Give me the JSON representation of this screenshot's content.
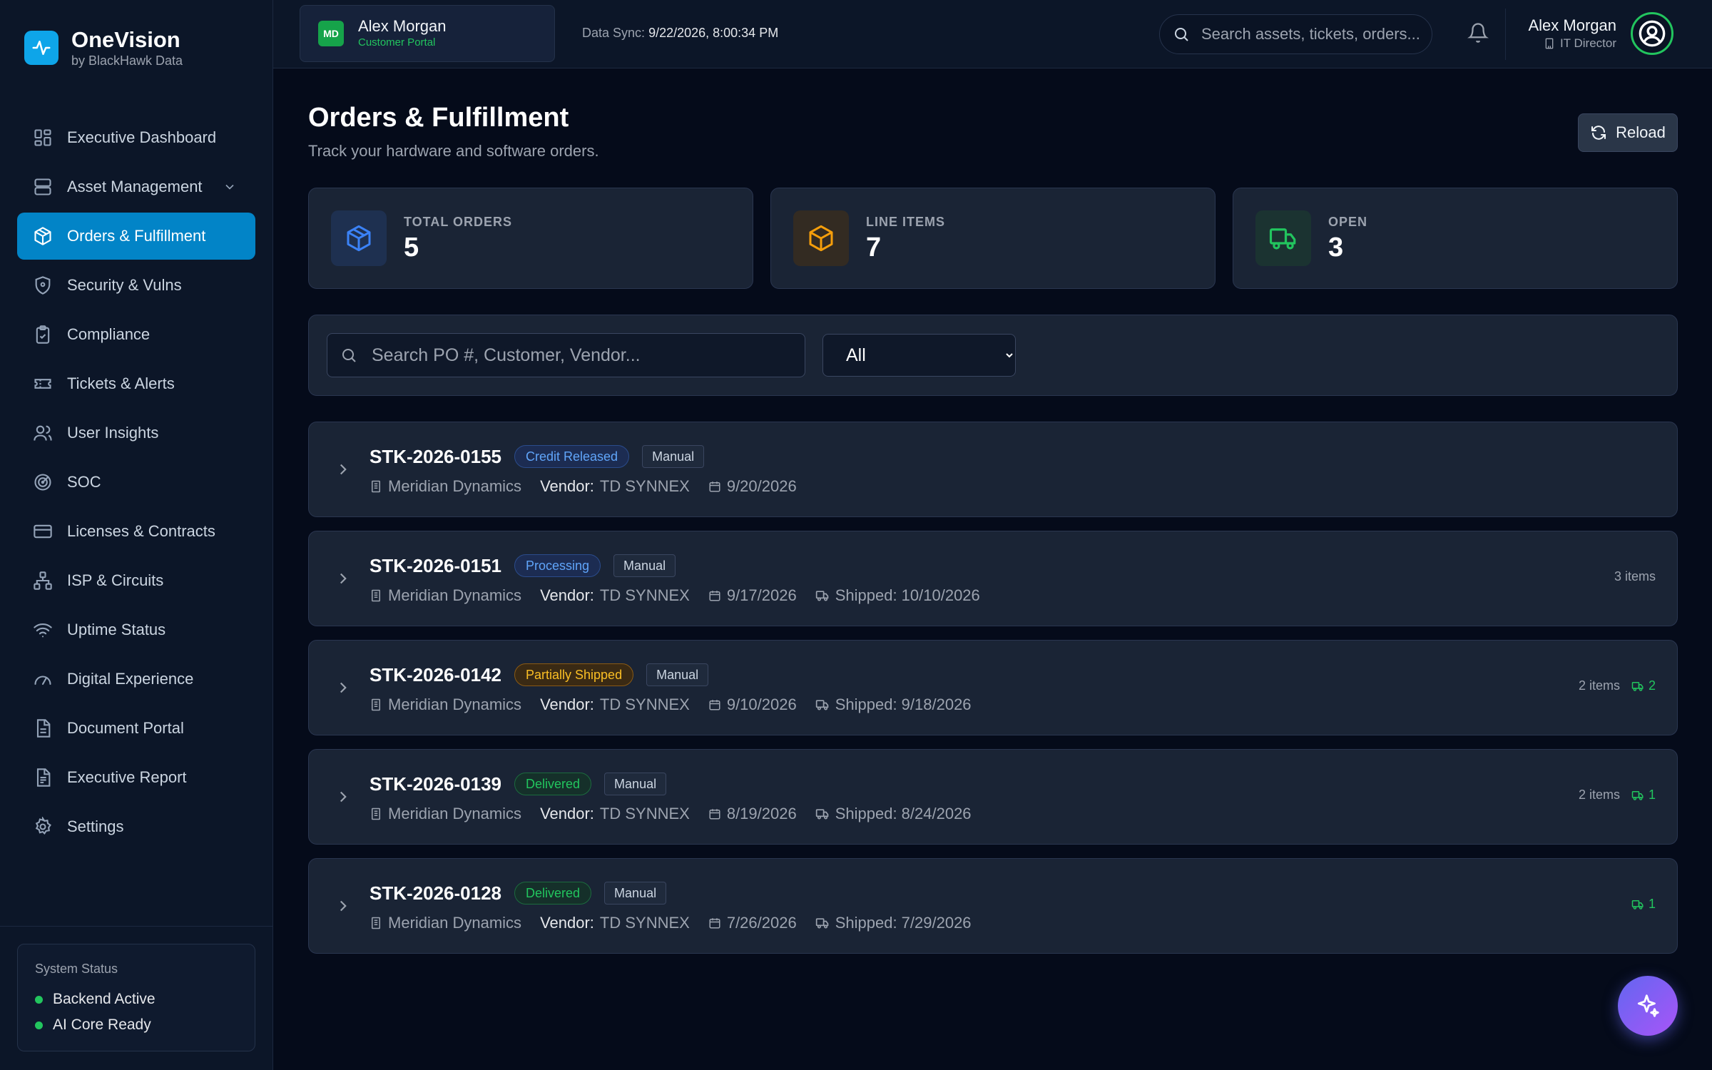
{
  "brand": {
    "name": "OneVision",
    "sub": "by BlackHawk Data"
  },
  "nav": [
    {
      "label": "Executive Dashboard",
      "icon": "dashboard-icon"
    },
    {
      "label": "Asset Management",
      "icon": "server-icon",
      "expandable": true
    },
    {
      "label": "Orders & Fulfillment",
      "icon": "package-icon",
      "active": true
    },
    {
      "label": "Security & Vulns",
      "icon": "shield-icon"
    },
    {
      "label": "Compliance",
      "icon": "clipboard-check-icon"
    },
    {
      "label": "Tickets & Alerts",
      "icon": "ticket-icon"
    },
    {
      "label": "User Insights",
      "icon": "users-icon"
    },
    {
      "label": "SOC",
      "icon": "radar-icon"
    },
    {
      "label": "Licenses & Contracts",
      "icon": "credit-card-icon"
    },
    {
      "label": "ISP & Circuits",
      "icon": "network-icon"
    },
    {
      "label": "Uptime Status",
      "icon": "wifi-icon"
    },
    {
      "label": "Digital Experience",
      "icon": "gauge-icon"
    },
    {
      "label": "Document Portal",
      "icon": "document-icon"
    },
    {
      "label": "Executive Report",
      "icon": "report-icon"
    },
    {
      "label": "Settings",
      "icon": "gear-icon"
    }
  ],
  "system_status": {
    "title": "System Status",
    "items": [
      "Backend Active",
      "AI Core Ready"
    ],
    "color": "#22c55e"
  },
  "topbar": {
    "tenant": {
      "badge": "MD",
      "name": "Alex Morgan",
      "sub": "Customer Portal"
    },
    "sync_label": "Data Sync:",
    "sync_value": "9/22/2026, 8:00:34 PM",
    "search_placeholder": "Search assets, tickets, orders...",
    "user": {
      "name": "Alex Morgan",
      "role": "IT Director"
    }
  },
  "page": {
    "title": "Orders & Fulfillment",
    "subtitle": "Track your hardware and software orders.",
    "reload_label": "Reload"
  },
  "stats": [
    {
      "label": "TOTAL ORDERS",
      "value": "5",
      "icon": "package-icon",
      "color": "#3b82f6"
    },
    {
      "label": "LINE ITEMS",
      "value": "7",
      "icon": "box-icon",
      "color": "#f59e0b"
    },
    {
      "label": "OPEN",
      "value": "3",
      "icon": "truck-icon",
      "color": "#22c55e"
    }
  ],
  "filters": {
    "search_placeholder": "Search PO #, Customer, Vendor...",
    "status_options": [
      "All"
    ],
    "status_selected": "All"
  },
  "orders": [
    {
      "po": "STK-2026-0155",
      "status": "Credit Released",
      "status_color": "#60a5fa",
      "source": "Manual",
      "customer": "Meridian Dynamics",
      "vendor_label": "Vendor:",
      "vendor": "TD SYNNEX",
      "date": "9/20/2026",
      "shipped": "",
      "items": "",
      "ship_count": ""
    },
    {
      "po": "STK-2026-0151",
      "status": "Processing",
      "status_color": "#60a5fa",
      "source": "Manual",
      "customer": "Meridian Dynamics",
      "vendor_label": "Vendor:",
      "vendor": "TD SYNNEX",
      "date": "9/17/2026",
      "shipped": "Shipped: 10/10/2026",
      "items": "3 items",
      "ship_count": ""
    },
    {
      "po": "STK-2026-0142",
      "status": "Partially Shipped",
      "status_color": "#f59e0b",
      "source": "Manual",
      "customer": "Meridian Dynamics",
      "vendor_label": "Vendor:",
      "vendor": "TD SYNNEX",
      "date": "9/10/2026",
      "shipped": "Shipped: 9/18/2026",
      "items": "2 items",
      "ship_count": "2"
    },
    {
      "po": "STK-2026-0139",
      "status": "Delivered",
      "status_color": "#22c55e",
      "source": "Manual",
      "customer": "Meridian Dynamics",
      "vendor_label": "Vendor:",
      "vendor": "TD SYNNEX",
      "date": "8/19/2026",
      "shipped": "Shipped: 8/24/2026",
      "items": "2 items",
      "ship_count": "1"
    },
    {
      "po": "STK-2026-0128",
      "status": "Delivered",
      "status_color": "#22c55e",
      "source": "Manual",
      "customer": "Meridian Dynamics",
      "vendor_label": "Vendor:",
      "vendor": "TD SYNNEX",
      "date": "7/26/2026",
      "shipped": "Shipped: 7/29/2026",
      "items": "",
      "ship_count": "1"
    }
  ]
}
